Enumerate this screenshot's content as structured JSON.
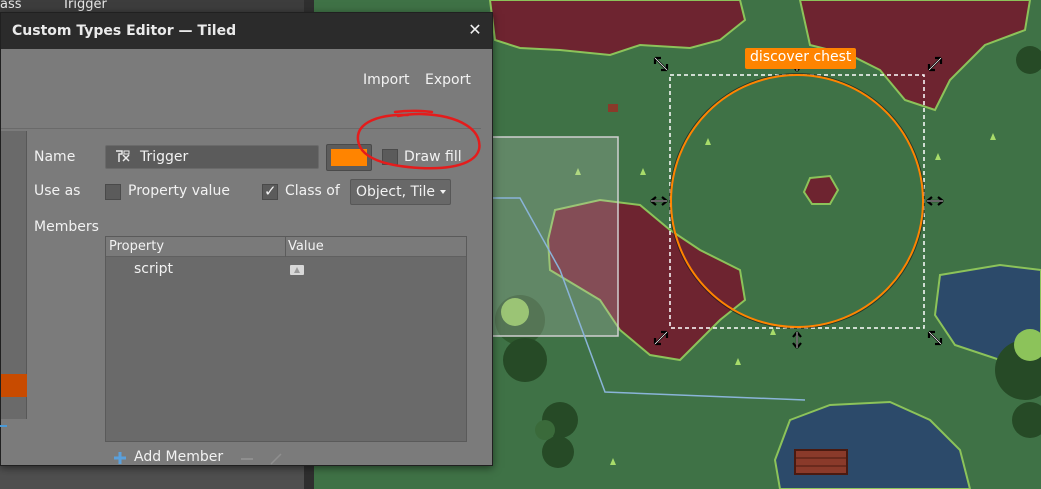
{
  "background_panel": {
    "col1": "ass",
    "col2": "Trigger"
  },
  "dialog": {
    "title": "Custom Types Editor — Tiled",
    "close_icon": "close-icon",
    "import_label": "Import",
    "export_label": "Export",
    "name_label": "Name",
    "name_value": "Trigger",
    "name_icon": "class-type-icon",
    "color_value": "#ff8400",
    "draw_fill_label": "Draw fill",
    "draw_fill_checked": false,
    "use_as_label": "Use as",
    "property_value_label": "Property value",
    "property_value_checked": false,
    "class_of_label": "Class of",
    "class_of_checked": true,
    "class_of_selected": "Object, Tile",
    "members_label": "Members",
    "table": {
      "columns": [
        "Property",
        "Value"
      ],
      "rows": [
        {
          "property": "script",
          "value_icon": "file-icon"
        }
      ]
    },
    "add_member_label": "Add Member",
    "remove_member_icon": "minus-icon",
    "rename_member_icon": "edit-icon"
  },
  "map": {
    "object_label": "discover chest",
    "accent_color": "#ff8400",
    "annotation_color": "#e41c1c"
  }
}
